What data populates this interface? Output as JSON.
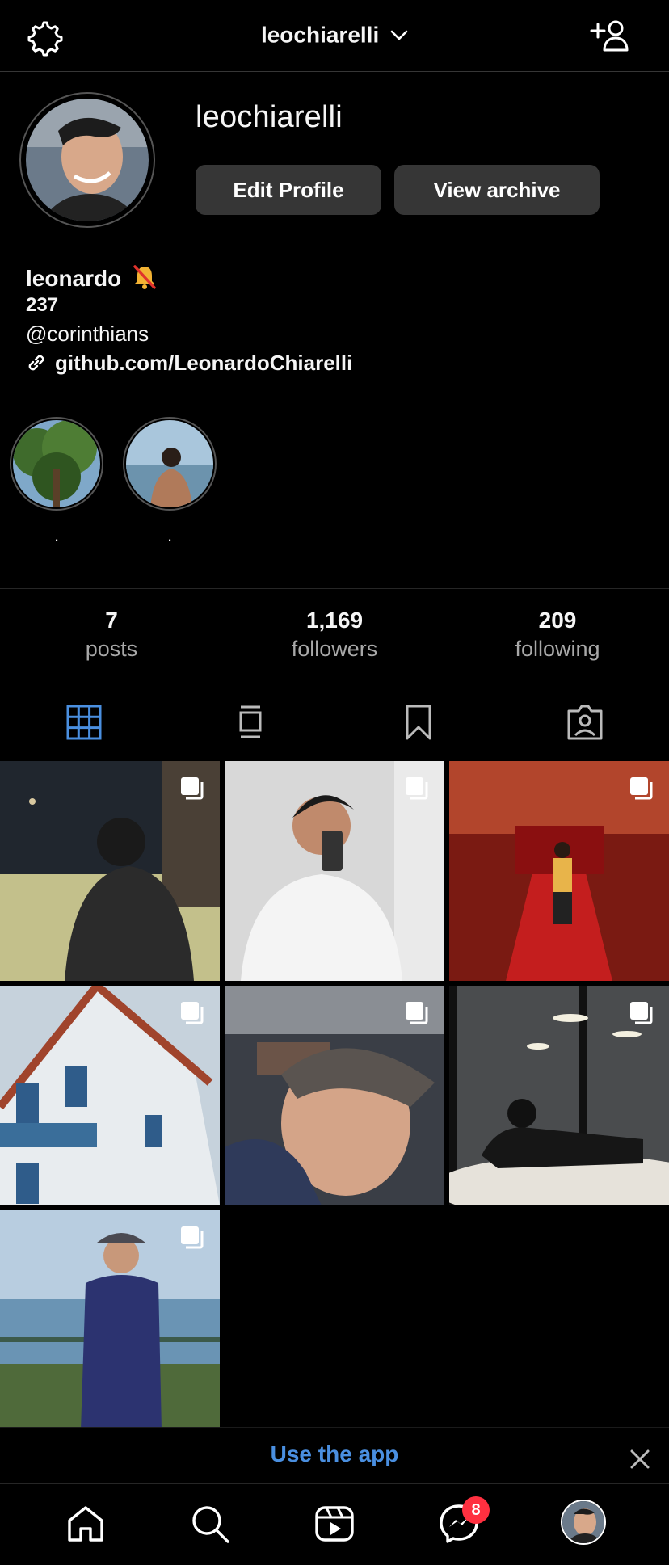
{
  "header": {
    "username": "leochiarelli"
  },
  "profile": {
    "display_username": "leochiarelli",
    "edit_label": "Edit Profile",
    "archive_label": "View archive"
  },
  "bio": {
    "name": "leonardo",
    "line1": "237",
    "line2": "@corinthians",
    "link": "github.com/LeonardoChiarelli"
  },
  "highlights": [
    {
      "label": ".",
      "icon": "tree-photo"
    },
    {
      "label": ".",
      "icon": "beach-photo"
    }
  ],
  "stats": [
    {
      "value": "7",
      "label": "posts"
    },
    {
      "value": "1,169",
      "label": "followers"
    },
    {
      "value": "209",
      "label": "following"
    }
  ],
  "tabs": [
    "grid-icon",
    "feed-icon",
    "saved-icon",
    "tagged-icon"
  ],
  "posts": [
    {
      "icon": "multi-post-icon"
    },
    {
      "icon": "multi-post-icon"
    },
    {
      "icon": "multi-post-icon"
    },
    {
      "icon": "multi-post-icon"
    },
    {
      "icon": "multi-post-icon"
    },
    {
      "icon": "multi-post-icon"
    },
    {
      "icon": "multi-post-icon"
    }
  ],
  "banner": {
    "text": "Use the app"
  },
  "bottom_nav": {
    "messages_badge": "8"
  },
  "colors": {
    "accent": "#4a8fe0",
    "badge": "#ff3040",
    "button": "#363636"
  }
}
